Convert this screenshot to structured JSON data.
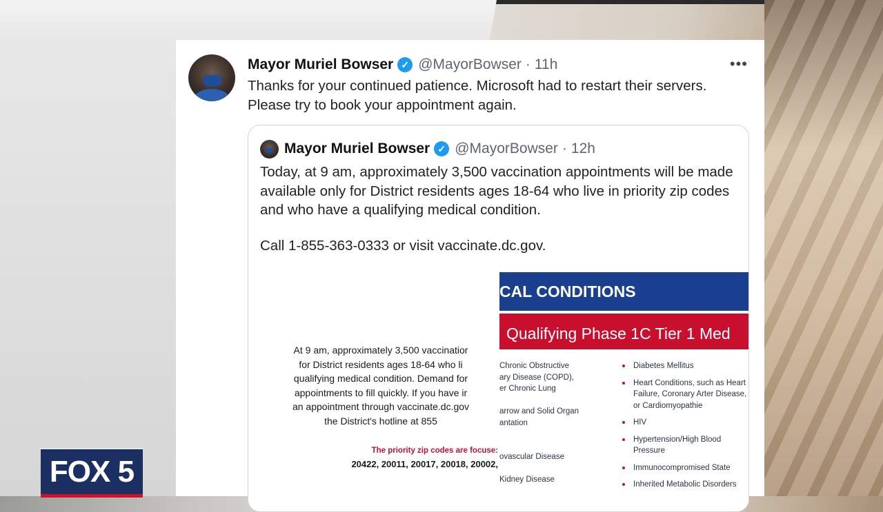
{
  "tweet": {
    "author_name": "Mayor Muriel Bowser",
    "handle": "@MayorBowser",
    "separator": "·",
    "time": "11h",
    "more": "•••",
    "text": "Thanks for your continued patience. Microsoft had to restart their servers. Please try to book your appointment again."
  },
  "quoted_tweet": {
    "author_name": "Mayor Muriel Bowser",
    "handle": "@MayorBowser",
    "separator": "·",
    "time": "12h",
    "text": "Today, at 9 am, approximately 3,500 vaccination appointments will be made available only for District residents ages 18-64 who live in priority zip codes and who have a qualifying medical condition.",
    "call_text": "Call 1-855-363-0333 or visit vaccinate.dc.gov."
  },
  "flyer": {
    "left_lines": [
      "At 9 am, approximately 3,500 vaccinatior",
      "for District residents ages 18-64 who li",
      "qualifying medical condition. Demand for",
      "appointments to fill quickly. If you have ir",
      "an appointment through vaccinate.dc.gov",
      "the District's hotline at 855"
    ],
    "priority_note": "The priority zip codes are focuse:",
    "zip_codes": "20422, 20011, 20017, 20018, 20002,",
    "band_blue": "CAL CONDITIONS",
    "band_red": "Qualifying Phase 1C Tier 1 Med",
    "col_a": [
      "Chronic Obstructive",
      "ary Disease (COPD),",
      "er Chronic Lung",
      "",
      "arrow and Solid Organ",
      "antation",
      "",
      "",
      "ovascular Disease",
      "",
      "Kidney Disease"
    ],
    "col_b": [
      "Diabetes Mellitus",
      "Heart Conditions, such as Heart Failure, Coronary Arter Disease, or Cardiomyopathie",
      "HIV",
      "Hypertension/High Blood Pressure",
      "Immunocompromised State",
      "Inherited Metabolic Disorders"
    ]
  },
  "logo": {
    "text": "FOX 5"
  },
  "colors": {
    "verified": "#1d9bf0",
    "flyer_blue": "#1b3f8f",
    "flyer_red": "#c8102e",
    "logo_navy": "#1b2f63"
  }
}
